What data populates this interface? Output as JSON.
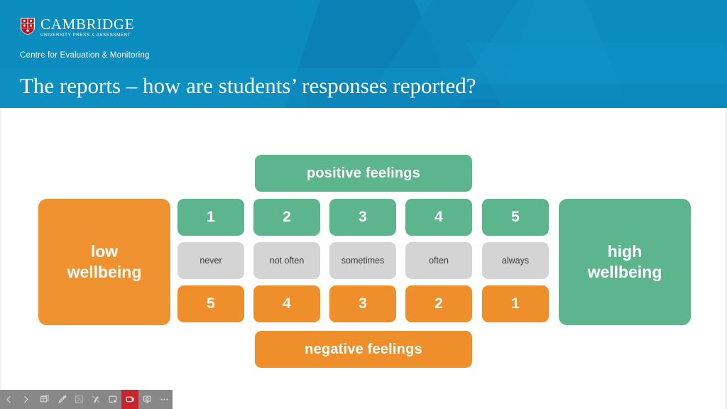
{
  "slide": {
    "title": "The reports – how are students’ responses reported?",
    "brand": {
      "wordmark": "CAMBRIDGE",
      "wordmark_sub": "UNIVERSITY PRESS & ASSESSMENT",
      "centre_line": "Centre for Evaluation & Monitoring",
      "crest_icon": "cambridge-crest-icon"
    },
    "colors": {
      "header_blue": "#0a8cbf",
      "green": "#5cb58c",
      "orange": "#ef8f2c",
      "grey": "#d4d4d4",
      "toolbar_grey": "#888888",
      "record_red": "#c8252b"
    }
  },
  "diagram": {
    "positive_band": "positive feelings",
    "negative_band": "negative feelings",
    "left_endcap": "low\nwellbeing",
    "left_endcap_line1": "low",
    "left_endcap_line2": "wellbeing",
    "right_endcap_line1": "high",
    "right_endcap_line2": "wellbeing",
    "columns": [
      {
        "positive": "1",
        "label": "never",
        "negative": "5"
      },
      {
        "positive": "2",
        "label": "not often",
        "negative": "4"
      },
      {
        "positive": "3",
        "label": "sometimes",
        "negative": "3"
      },
      {
        "positive": "4",
        "label": "often",
        "negative": "2"
      },
      {
        "positive": "5",
        "label": "always",
        "negative": "1"
      }
    ]
  },
  "toolbar": {
    "buttons": [
      {
        "name": "previous-slide-button",
        "icon": "chevron-left-icon",
        "label": "Previous",
        "active": false
      },
      {
        "name": "next-slide-button",
        "icon": "chevron-right-icon",
        "label": "Next",
        "active": false
      },
      {
        "name": "all-slides-button",
        "icon": "grid-slides-icon",
        "label": "All slides",
        "active": false
      },
      {
        "name": "pen-button",
        "icon": "pen-icon",
        "label": "Pen",
        "active": false
      },
      {
        "name": "highlighter-button",
        "icon": "highlighter-icon",
        "label": "Highlighter",
        "active": false
      },
      {
        "name": "eraser-button",
        "icon": "eraser-icon",
        "label": "Eraser",
        "active": false
      },
      {
        "name": "subtitles-button",
        "icon": "subtitles-icon",
        "label": "Subtitles",
        "active": false
      },
      {
        "name": "stop-recording-button",
        "icon": "record-stop-icon",
        "label": "Stop recording",
        "active": true
      },
      {
        "name": "present-button",
        "icon": "present-screen-icon",
        "label": "Present",
        "active": false
      },
      {
        "name": "more-options-button",
        "icon": "ellipsis-icon",
        "label": "More options",
        "active": false
      }
    ]
  }
}
